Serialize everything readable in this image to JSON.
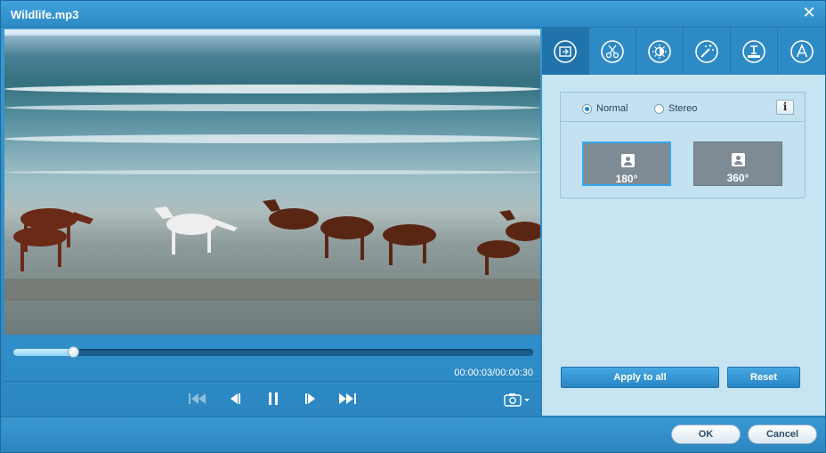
{
  "window": {
    "title": "Wildlife.mp3",
    "close_glyph": "✕"
  },
  "player": {
    "progress_fraction": 0.115,
    "time_display": "00:00:03/00:00:30",
    "buttons": [
      "skip-back-icon",
      "step-back-icon",
      "pause-icon",
      "step-forward-icon",
      "skip-forward-icon"
    ],
    "snapshot_icon": "camera-icon"
  },
  "tabs": [
    {
      "icon": "rotate-icon",
      "active": true
    },
    {
      "icon": "scissors-icon",
      "active": false
    },
    {
      "icon": "brightness-icon",
      "active": false
    },
    {
      "icon": "magic-wand-icon",
      "active": false
    },
    {
      "icon": "watermark-icon",
      "active": false
    },
    {
      "icon": "text-icon",
      "active": false
    }
  ],
  "mode": {
    "normal_label": "Normal",
    "stereo_label": "Stereo",
    "selected": "Normal",
    "info_label": "i"
  },
  "rotation": {
    "option_180": "180°",
    "option_360": "360°",
    "selected": "180°"
  },
  "actions": {
    "apply_all_label": "Apply to all",
    "reset_label": "Reset"
  },
  "footer": {
    "ok_label": "OK",
    "cancel_label": "Cancel"
  },
  "colors": {
    "accent": "#2e8ac4",
    "panel": "#c7e4f3",
    "selected_border": "#36a7ec"
  }
}
